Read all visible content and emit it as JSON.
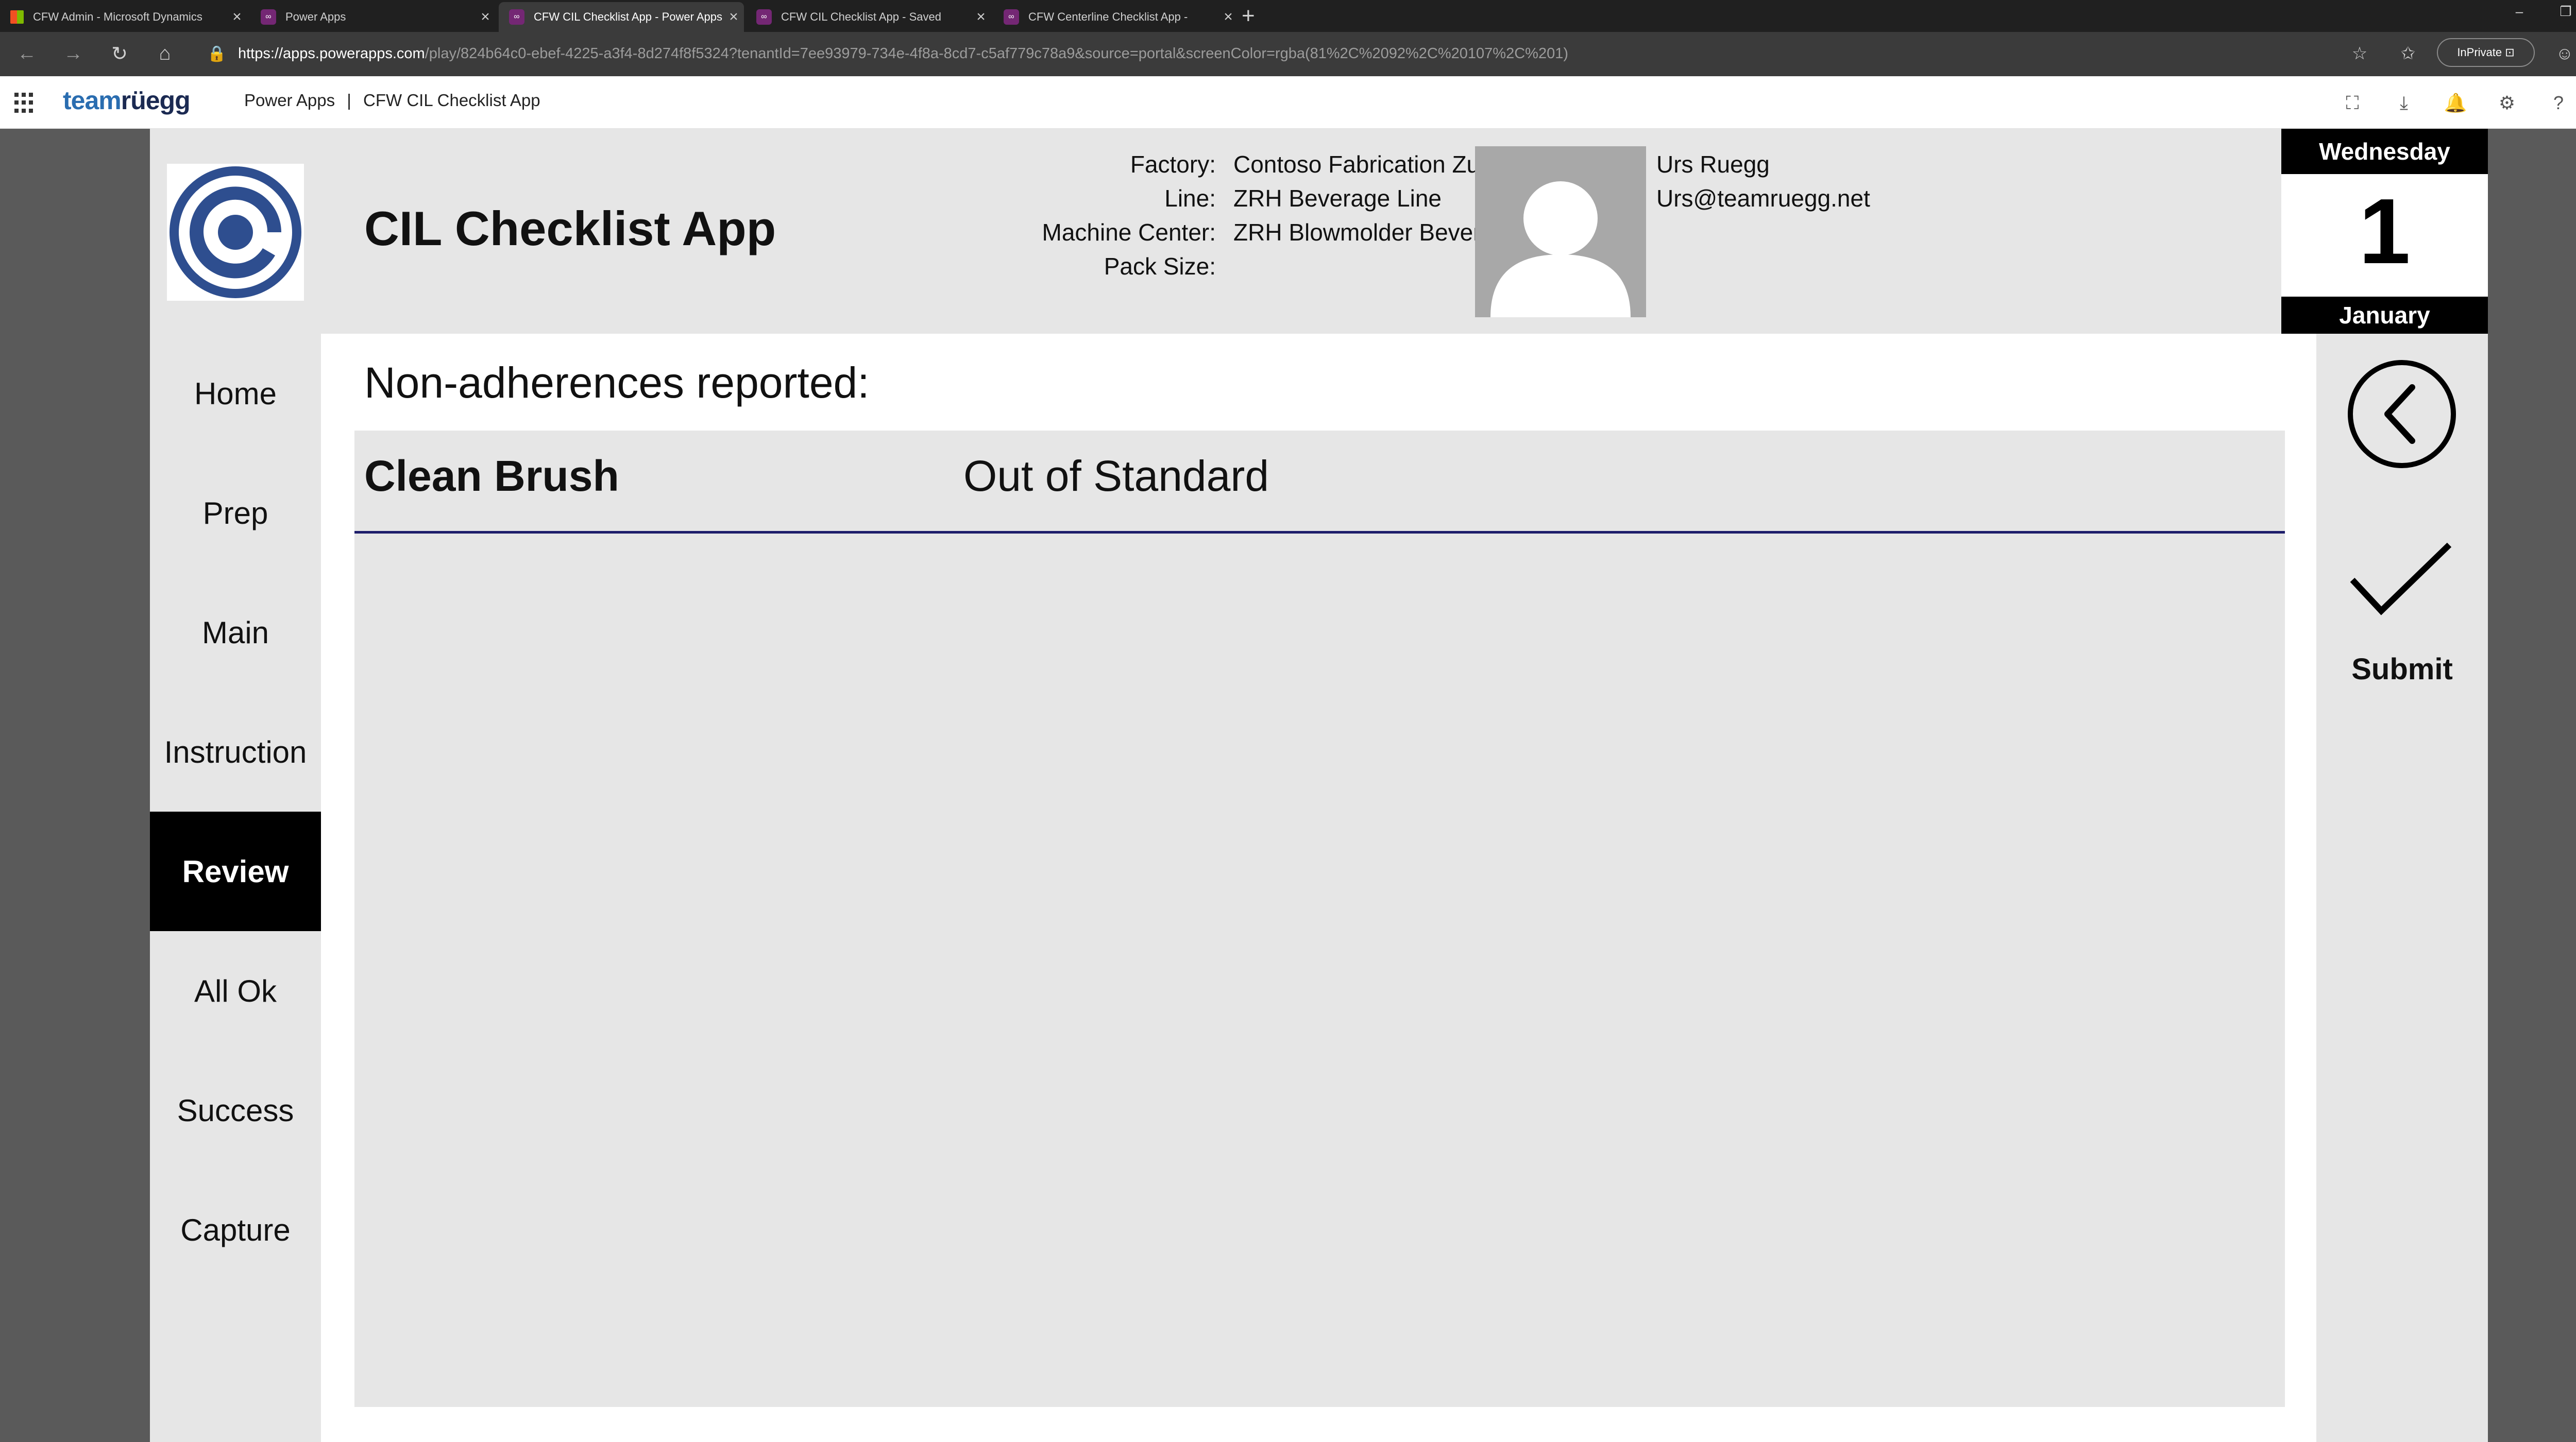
{
  "browser": {
    "tabs": [
      {
        "title": "CFW Admin - Microsoft Dynamics",
        "favicon": "microsoft-icon",
        "active": false
      },
      {
        "title": "Power Apps",
        "favicon": "power-apps-icon",
        "active": false
      },
      {
        "title": "CFW CIL Checklist App - Power Apps",
        "favicon": "power-apps-icon",
        "active": true
      },
      {
        "title": "CFW CIL Checklist App - Saved",
        "favicon": "power-apps-icon",
        "active": false
      },
      {
        "title": "CFW Centerline Checklist App -",
        "favicon": "power-apps-icon",
        "active": false
      }
    ],
    "url_host": "https://apps.powerapps.com",
    "url_rest": "/play/824b64c0-ebef-4225-a3f4-8d274f8f5324?tenantId=7ee93979-734e-4f8a-8cd7-c5af779c78a9&source=portal&screenColor=rgba(81%2C%2092%2C%20107%2C%201)",
    "inprivate_label": "InPrivate"
  },
  "powerapps_header": {
    "brand_team": "team",
    "brand_ruegg": "rüegg",
    "product": "Power Apps",
    "separator": "|",
    "app_name": "CFW CIL Checklist App"
  },
  "app": {
    "title": "CIL Checklist App",
    "info": [
      {
        "label": "Factory:",
        "value": "Contoso Fabrication Zurich"
      },
      {
        "label": "Line:",
        "value": "ZRH Beverage Line"
      },
      {
        "label": "Machine Center:",
        "value": "ZRH Blowmolder Beverage 1"
      },
      {
        "label": "Pack Size:",
        "value": ""
      }
    ],
    "user": {
      "name": "Urs Ruegg",
      "email": "Urs@teamruegg.net"
    },
    "date": {
      "weekday": "Wednesday",
      "day": "1",
      "month": "January"
    },
    "nav": [
      {
        "label": "Home",
        "active": false
      },
      {
        "label": "Prep",
        "active": false
      },
      {
        "label": "Main",
        "active": false
      },
      {
        "label": "Instruction",
        "active": false
      },
      {
        "label": "Review",
        "active": true
      },
      {
        "label": "All Ok",
        "active": false
      },
      {
        "label": "Success",
        "active": false
      },
      {
        "label": "Capture",
        "active": false
      }
    ],
    "section_title": "Non-adherences reported:",
    "gallery": [
      {
        "item": "Clean Brush",
        "status": "Out of Standard"
      }
    ],
    "submit_label": "Submit"
  },
  "colors": {
    "panel_gray": "#e6e6e6",
    "page_gray": "#5a5a5a",
    "active_nav": "#000000",
    "row_divider": "#1e1e6b",
    "brand_blue": "#2a6db0",
    "brand_navy": "#1b2a52"
  }
}
